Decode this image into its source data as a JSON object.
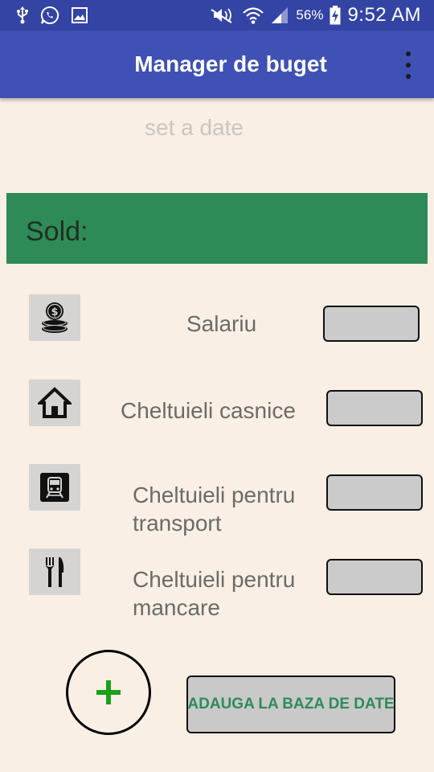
{
  "status_bar": {
    "left_icons": [
      "usb-icon",
      "whatsapp-icon",
      "gallery-icon"
    ],
    "right_icons": [
      "mute-icon",
      "wifi-icon",
      "signal-icon",
      "battery-charging-icon"
    ],
    "battery_percent": "56%",
    "time": "9:52 AM"
  },
  "toolbar": {
    "title": "Manager de buget",
    "menu_icon": "overflow-menu-icon"
  },
  "date": {
    "placeholder": "set a date"
  },
  "balance": {
    "label": "Sold:"
  },
  "categories": [
    {
      "icon": "coins-icon",
      "label": "Salariu"
    },
    {
      "icon": "home-icon",
      "label": "Cheltuieli casnice"
    },
    {
      "icon": "train-icon",
      "label_line1": "Cheltuieli pentru",
      "label_line2": "transport"
    },
    {
      "icon": "cutlery-icon",
      "label_line1": "Cheltuieli pentru",
      "label_line2": "mancare"
    }
  ],
  "actions": {
    "add_icon": "plus-icon",
    "save_label": "ADAUGA LA BAZA DE DATE"
  },
  "colors": {
    "status_bar": "#3344a5",
    "toolbar": "#3f51b5",
    "background": "#f9efe4",
    "balance_bar": "#2e8b57",
    "accent_green": "#2e8b57",
    "plus_green": "#1aa01a"
  }
}
